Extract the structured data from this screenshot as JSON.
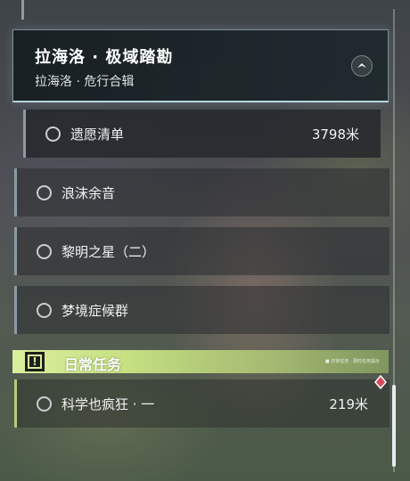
{
  "quest": {
    "title": "拉海洛 · 极域踏勘",
    "subtitle": "拉海洛 · 危行合辑"
  },
  "subtasks": [
    {
      "label": "遗愿清单",
      "distance": "3798米"
    }
  ],
  "tasks": [
    {
      "label": "浪沫余音"
    },
    {
      "label": "黎明之星（二）"
    },
    {
      "label": "梦境症候群"
    }
  ],
  "daily": {
    "title": "日常任务",
    "tag": "■ 日常任务 · 限时任务提示",
    "tasks": [
      {
        "label": "科学也疯狂 · 一",
        "distance": "219米"
      }
    ]
  },
  "icons": {
    "collapse": "chevron-up-icon",
    "task_status": "circle-icon",
    "daily": "exclamation-icon",
    "marker": "diamond-marker-icon"
  },
  "colors": {
    "daily_accent": "#c6e082",
    "marker": "#d94a5a"
  }
}
